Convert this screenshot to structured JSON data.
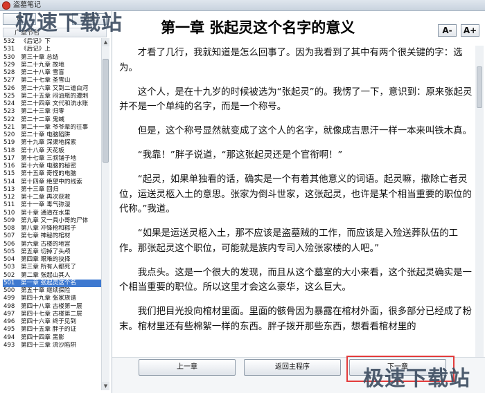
{
  "window": {
    "title": "盗墓笔记"
  },
  "watermark": "极速下载站",
  "left_panel": {
    "tab_a": "包",
    "tab_b": "目录",
    "list_header": "广章节名",
    "chapters": [
      {
        "num": "532",
        "title": "《后记》下"
      },
      {
        "num": "531",
        "title": "《后记》上"
      },
      {
        "num": "530",
        "title": "第三十章 总结"
      },
      {
        "num": "529",
        "title": "第二十九章 故地"
      },
      {
        "num": "528",
        "title": "第二十八章 雪盲"
      },
      {
        "num": "527",
        "title": "第二十七章 圣雪山"
      },
      {
        "num": "526",
        "title": "第二十六章 又到二道白河"
      },
      {
        "num": "525",
        "title": "第二十五章 闷油瓶的遭刺"
      },
      {
        "num": "524",
        "title": "第二十四章 文代和流水账"
      },
      {
        "num": "523",
        "title": "第二十三章 归零"
      },
      {
        "num": "522",
        "title": "第二十二章 鬼蜮"
      },
      {
        "num": "521",
        "title": "第二十一章 爷爷辈的往事"
      },
      {
        "num": "520",
        "title": "第二十章 电脑陷阱"
      },
      {
        "num": "519",
        "title": "第十九章 深渠地探索"
      },
      {
        "num": "518",
        "title": "第十八章 天花板"
      },
      {
        "num": "517",
        "title": "第十七章 三叔铺子地"
      },
      {
        "num": "516",
        "title": "第十六章 电脑的秘密"
      },
      {
        "num": "515",
        "title": "第十五章 奇怪的电脑"
      },
      {
        "num": "514",
        "title": "第十四章 绝望中的线索"
      },
      {
        "num": "513",
        "title": "第十三章 回归"
      },
      {
        "num": "512",
        "title": "第十二章 再次获救"
      },
      {
        "num": "511",
        "title": "第十一章 毒气弥漫"
      },
      {
        "num": "510",
        "title": "第十章 通道在水里"
      },
      {
        "num": "509",
        "title": "第九章 又一具小哥的尸体"
      },
      {
        "num": "508",
        "title": "第八章 冲锋枪和粽子"
      },
      {
        "num": "507",
        "title": "第七章 神秘的棺材"
      },
      {
        "num": "506",
        "title": "第六章 古楼的地宫"
      },
      {
        "num": "505",
        "title": "第五章 切掉了头颅"
      },
      {
        "num": "504",
        "title": "第四章 艰难的抉择"
      },
      {
        "num": "503",
        "title": "第三章 所有人都死了"
      },
      {
        "num": "502",
        "title": "第二章 张起山其人"
      },
      {
        "num": "501",
        "title": "第一章 张起灵这个名"
      },
      {
        "num": "500",
        "title": "第五十章 继续探险"
      },
      {
        "num": "499",
        "title": "第四十九章 张家族谱"
      },
      {
        "num": "498",
        "title": "第四十八章 古楼第一层"
      },
      {
        "num": "497",
        "title": "第四十七章 古楼第二层"
      },
      {
        "num": "496",
        "title": "第四十六章 终于见到"
      },
      {
        "num": "495",
        "title": "第四十五章 胖子的证"
      },
      {
        "num": "494",
        "title": "第四十四章 黑影"
      },
      {
        "num": "493",
        "title": "第四十三章 流沙陷阱"
      }
    ],
    "selected_chapter": "501"
  },
  "content": {
    "chapter_title": "第一章 张起灵这个名字的意义",
    "font_decrease": "A-",
    "font_increase": "A+",
    "paragraphs": [
      "才看了几行，我就知道是怎么回事了。因为我看到了其中有两个很关键的字：选为。",
      "这个人，是在十九岁的时候被选为“张起灵”的。我愣了一下，意识到：原来张起灵并不是一个单纯的名字，而是一个称号。",
      "但是，这个称号显然就变成了这个人的名字，就像成吉思汗一样一本来叫铁木真。",
      "“我靠！”胖子说道，“那这张起灵还是个官衔啊！”",
      "“起灵，如果单独看的话，确实是一个有着其他意义的词语。起灵嘛，撤除亡者灵位，运送灵柩入土的意思。张家为倒斗世家，这张起灵，也许是某个相当重要的职位的代称。”我道。",
      "“如果是运送灵柩入土，那不应该是盗墓贼的工作，而应该是入殓送葬队伍的工作。那张起灵这个职位，可能就是族内专司入殓张家楼的人吧。”",
      "我点头。这是一个很大的发现，而且从这个墓室的大小来看，这个张起灵确实是一个相当重要的职位。所以这里才会这么豪华，这么巨大。",
      "我们把目光投向棺材里面。里面的骸骨因为暴露在棺材外面，很多部分已经成了粉末。棺材里还有些棉絮一样的东西。胖子拨开那些东西，想看看棺材里的"
    ]
  },
  "footer": {
    "prev_label": "上一章",
    "home_label": "返回主程序",
    "next_label": "下一章"
  }
}
